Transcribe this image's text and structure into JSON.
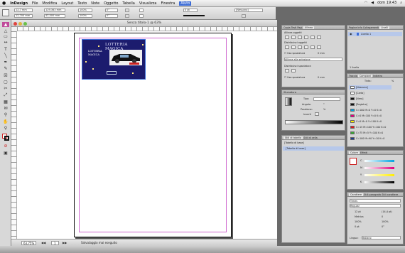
{
  "menubar": {
    "items": [
      "InDesign",
      "File",
      "Modifica",
      "Layout",
      "Testo",
      "Note",
      "Oggetto",
      "Tabella",
      "Visualizza",
      "Finestra",
      "Aiuto"
    ],
    "selected": "Aiuto",
    "right": [
      "dom 19:43"
    ]
  },
  "control": {
    "x": "12,7 mm",
    "y": "12,700 mm",
    "w": "129,363 mm",
    "h": "42,000 mm",
    "zoom": "100%",
    "angle": "0°",
    "stroke": "0 pt",
    "mode": "[Nessuno]"
  },
  "document": {
    "title": "Senza titolo-1 @ 63%",
    "status_zoom": "63,75%",
    "status_page": "1",
    "status_text": "Salvataggio mai eseguito"
  },
  "ad": {
    "title": "LOTTERIA MAGICA",
    "sub_line1": "LOTTERIA",
    "sub_line2": "MAGICA"
  },
  "panel_allinea": {
    "tabs": [
      "Copia",
      "Testi",
      "Pagi",
      "Allinea"
    ],
    "active": "Allinea",
    "h_align": "Allinea oggetti",
    "distribute": "Distribuisci oggetti",
    "use_spacing": "Usa spaziatura",
    "spacing_val": "0 mm",
    "align_to": "Allinea alla selezione",
    "distribute_spacing": "Distribuisci spaziatura",
    "use_spacing2": "Usa spaziatura",
    "spacing_val2": "0 mm"
  },
  "panel_sfumatura": {
    "tab": "Sfumatura",
    "tipo_label": "Tipo:",
    "angolo_label": "Angolo:",
    "posizione_label": "Posizione:",
    "inverti_label": "Inverti",
    "posizione_pct": "%",
    "angolo_deg": "°"
  },
  "panel_stili": {
    "tabs": [
      "Stili di tabella",
      "Stili di cella"
    ],
    "active": "Stili di tabella",
    "item": "[Tabella di base]",
    "selected": "[Tabella di base]"
  },
  "panel_livelli": {
    "tabs": [
      "Pagine",
      "Info",
      "Collegamenti",
      "Livelli"
    ],
    "active": "Livelli",
    "layer": "Livello 1",
    "footer": "1 livello"
  },
  "panel_campioni": {
    "tabs": [
      "Traccia",
      "Campioni",
      "Indietro"
    ],
    "active": "Campioni",
    "tinta_label": "Tinta:",
    "tinta_val": "%",
    "swatches": [
      {
        "name": "[Nessuno]",
        "color": "#ffffff",
        "sel": true
      },
      {
        "name": "[Carta]",
        "color": "#ffffff"
      },
      {
        "name": "[Nero]",
        "color": "#111111"
      },
      {
        "name": "[Registro]",
        "color": "#111111"
      },
      {
        "name": "C=100 M=0 Y=0 K=0",
        "color": "#00a3e0"
      },
      {
        "name": "C=0 M=100 Y=0 K=0",
        "color": "#e3007d"
      },
      {
        "name": "C=0 M=0 Y=100 K=0",
        "color": "#ffed00"
      },
      {
        "name": "C=15 M=100 Y=100 K=0",
        "color": "#d71920"
      },
      {
        "name": "C=75 M=5 Y=100 K=0",
        "color": "#3aa935"
      },
      {
        "name": "C=100 M=90 Y=10 K=0",
        "color": "#1f3d8f"
      }
    ]
  },
  "panel_colore": {
    "tabs": [
      "Colore",
      "Effetti"
    ],
    "active": "Colore",
    "c": "C",
    "m": "M",
    "y": "Y",
    "k": "K"
  },
  "panel_carattere": {
    "tabs": [
      "Carattere",
      "Stili paragrafo",
      "Stili carattere"
    ],
    "active": "Carattere",
    "font": "Times",
    "style": "Regular",
    "size": "12 pt",
    "leading": "(14,4 pt)",
    "kern": "Metrica",
    "track": "0",
    "vscale": "100%",
    "hscale": "100%",
    "baseline": "0 pt",
    "skew": "0°",
    "lang_label": "Lingua:",
    "lang": "Italiano"
  }
}
